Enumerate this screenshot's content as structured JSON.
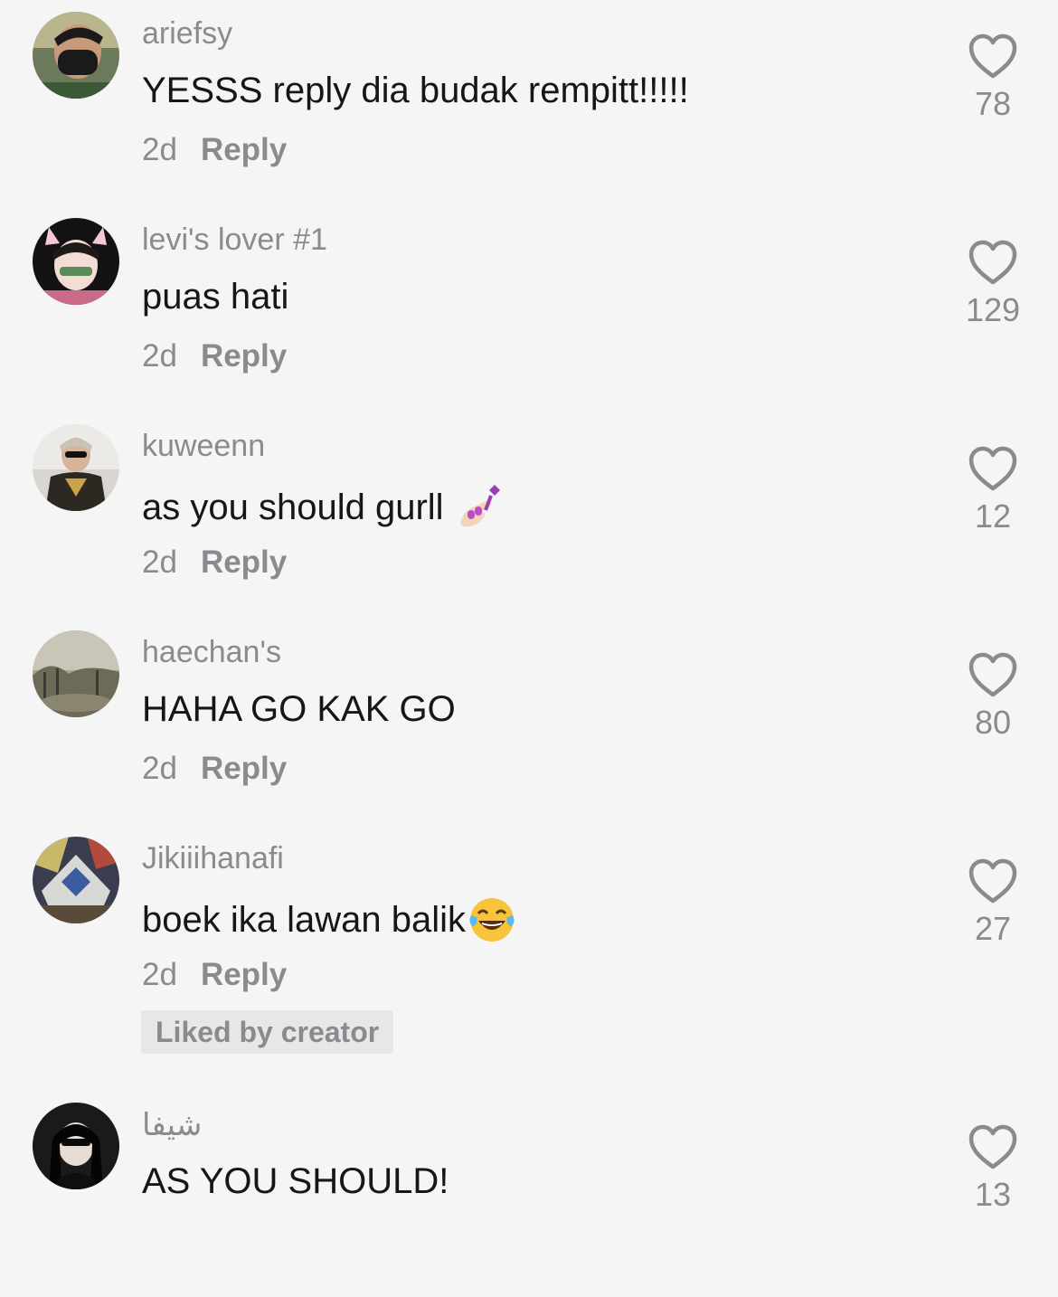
{
  "comments": [
    {
      "username": "ariefsy",
      "text": "YESSS reply dia budak rempitt!!!!!",
      "emoji": "",
      "time": "2d",
      "reply_label": "Reply",
      "likes": "78"
    },
    {
      "username": "levi's lover #1",
      "text": "puas hati",
      "emoji": "",
      "time": "2d",
      "reply_label": "Reply",
      "likes": "129"
    },
    {
      "username": "kuweenn",
      "text": "as you should gurll",
      "emoji": "nail-polish-emoji",
      "time": "2d",
      "reply_label": "Reply",
      "likes": "12"
    },
    {
      "username": "haechan's",
      "text": "HAHA GO KAK GO",
      "emoji": "",
      "time": "2d",
      "reply_label": "Reply",
      "likes": "80"
    },
    {
      "username": "Jikiiihanafi",
      "text": "boek ika lawan balik",
      "emoji": "tears-of-joy-emoji",
      "time": "2d",
      "reply_label": "Reply",
      "likes": "27",
      "badge": "Liked by creator"
    },
    {
      "username": "شيفا",
      "text": "AS YOU SHOULD!",
      "emoji": "",
      "time": "",
      "reply_label": "",
      "likes": "13"
    }
  ],
  "icons": {
    "like": "heart-outline-icon"
  },
  "colors": {
    "background": "#f5f5f5",
    "text": "#161616",
    "muted": "#8a8a8f",
    "badge_bg": "#e7e7e7"
  }
}
